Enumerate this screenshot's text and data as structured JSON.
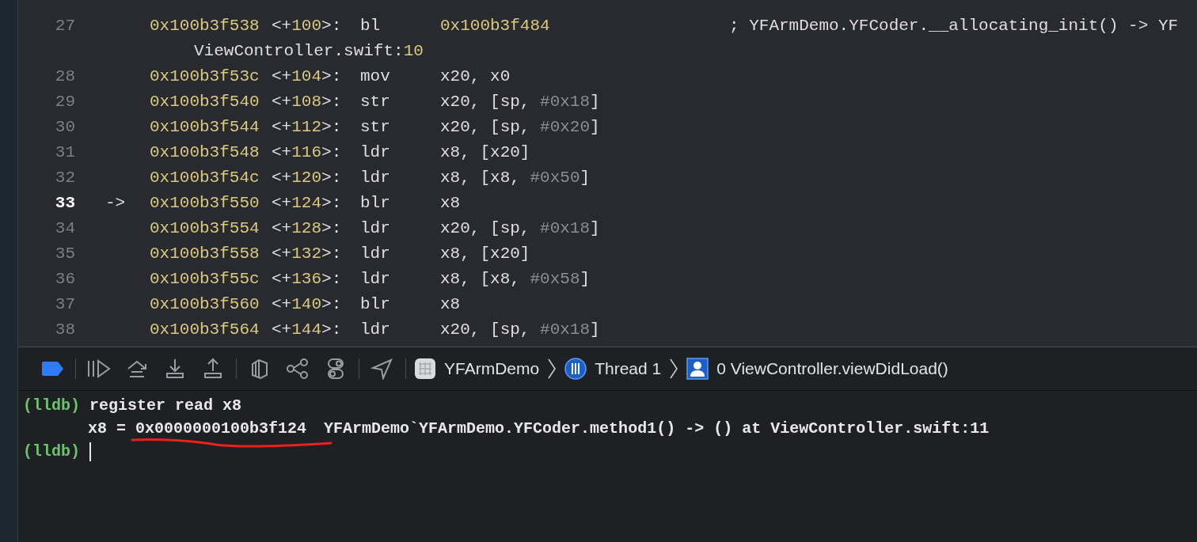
{
  "disassembly": {
    "lines": [
      {
        "number": "27",
        "current": false,
        "address": "0x100b3f538",
        "offset": "<+100>:",
        "mnemonic": "bl",
        "operands": "0x100b3f484",
        "comment": "; YFArmDemo.YFCoder.__allocating_init() -> YF",
        "source_file": "ViewController.swift:",
        "source_line": "10"
      },
      {
        "number": "28",
        "current": false,
        "address": "0x100b3f53c",
        "offset": "<+104>:",
        "mnemonic": "mov",
        "operands": "x20, x0"
      },
      {
        "number": "29",
        "current": false,
        "address": "0x100b3f540",
        "offset": "<+108>:",
        "mnemonic": "str",
        "operands": "x20, [sp, #0x18]"
      },
      {
        "number": "30",
        "current": false,
        "address": "0x100b3f544",
        "offset": "<+112>:",
        "mnemonic": "str",
        "operands": "x20, [sp, #0x20]"
      },
      {
        "number": "31",
        "current": false,
        "address": "0x100b3f548",
        "offset": "<+116>:",
        "mnemonic": "ldr",
        "operands": "x8, [x20]"
      },
      {
        "number": "32",
        "current": false,
        "address": "0x100b3f54c",
        "offset": "<+120>:",
        "mnemonic": "ldr",
        "operands": "x8, [x8, #0x50]"
      },
      {
        "number": "33",
        "current": true,
        "marker": "->",
        "address": "0x100b3f550",
        "offset": "<+124>:",
        "mnemonic": "blr",
        "operands": "x8"
      },
      {
        "number": "34",
        "current": false,
        "address": "0x100b3f554",
        "offset": "<+128>:",
        "mnemonic": "ldr",
        "operands": "x20, [sp, #0x18]"
      },
      {
        "number": "35",
        "current": false,
        "address": "0x100b3f558",
        "offset": "<+132>:",
        "mnemonic": "ldr",
        "operands": "x8, [x20]"
      },
      {
        "number": "36",
        "current": false,
        "address": "0x100b3f55c",
        "offset": "<+136>:",
        "mnemonic": "ldr",
        "operands": "x8, [x8, #0x58]"
      },
      {
        "number": "37",
        "current": false,
        "address": "0x100b3f560",
        "offset": "<+140>:",
        "mnemonic": "blr",
        "operands": "x8"
      },
      {
        "number": "38",
        "current": false,
        "address": "0x100b3f564",
        "offset": "<+144>:",
        "mnemonic": "ldr",
        "operands": "x20, [sp, #0x18]"
      }
    ]
  },
  "debug_bar": {
    "breadcrumb": [
      {
        "kind": "app",
        "label": "YFArmDemo"
      },
      {
        "kind": "thread",
        "label": "Thread 1"
      },
      {
        "kind": "frame",
        "label": "0 ViewController.viewDidLoad()"
      }
    ]
  },
  "console": {
    "lines": [
      {
        "kind": "command",
        "prompt": "(lldb)",
        "text": "register read x8"
      },
      {
        "kind": "output",
        "name": "x8 =",
        "value": "0x0000000100b3f124",
        "underlined": true,
        "detail": "YFArmDemo`YFArmDemo.YFCoder.method1() -> () at ViewController.swift:11"
      },
      {
        "kind": "prompt",
        "prompt": "(lldb)"
      }
    ]
  }
}
